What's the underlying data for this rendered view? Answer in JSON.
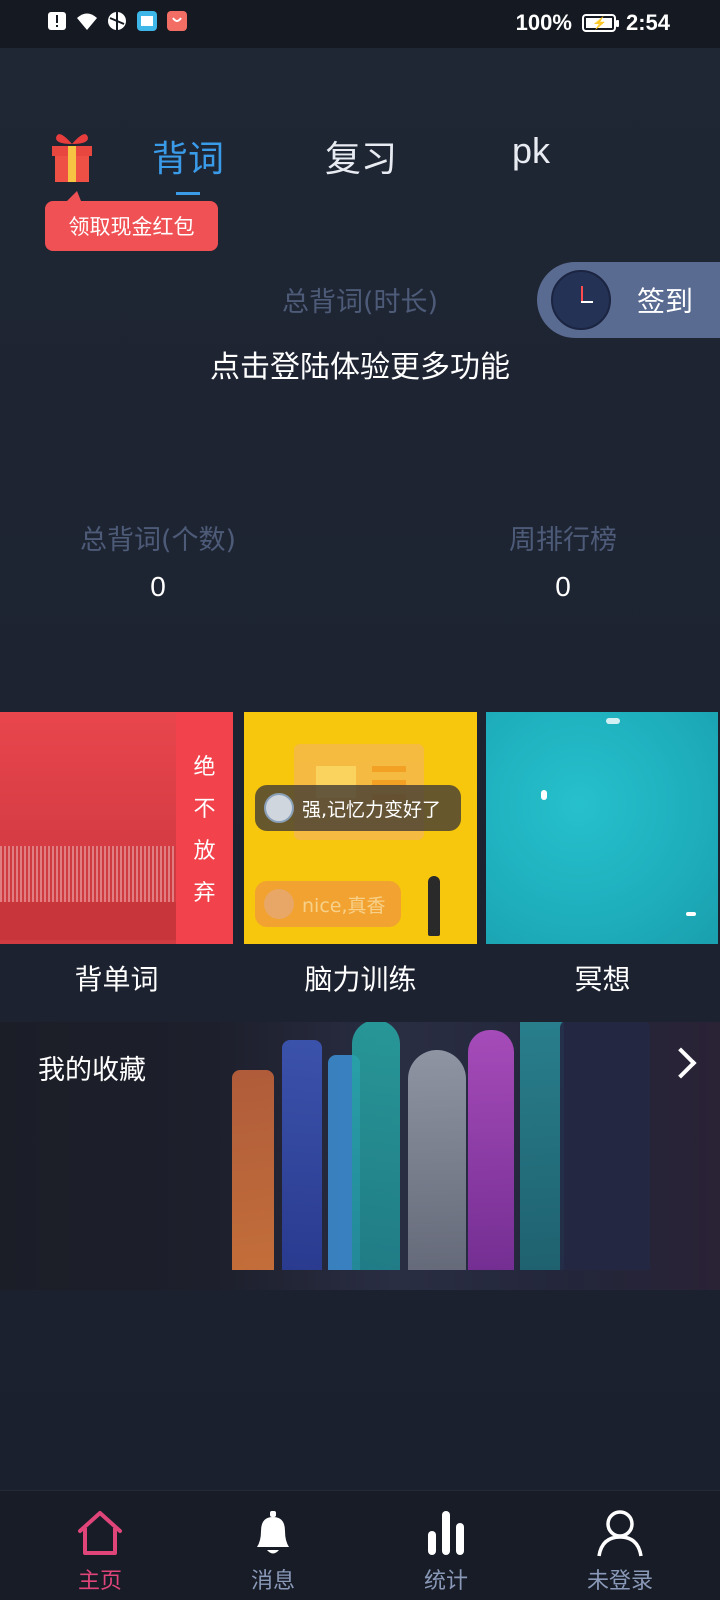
{
  "status_bar": {
    "battery_percent": "100%",
    "time": "2:54",
    "icons": [
      "alert-icon",
      "wifi-icon",
      "vpn-icon",
      "book-app-icon",
      "shop-app-icon"
    ]
  },
  "tabs": [
    {
      "label": "背词",
      "active": true
    },
    {
      "label": "复习",
      "active": false
    },
    {
      "label": "pk",
      "active": false
    }
  ],
  "red_packet": {
    "label": "领取现金红包",
    "icon": "gift-icon"
  },
  "sign_in": {
    "label": "签到",
    "icon": "clock-icon"
  },
  "summary": {
    "total_time_label": "总背词(时长)",
    "login_hint": "点击登陆体验更多功能",
    "total_count_label": "总背词(个数)",
    "total_count_value": "0",
    "weekly_rank_label": "周排行榜",
    "weekly_rank_value": "0"
  },
  "tiles": [
    {
      "label": "背单词",
      "banner_chars": [
        "绝",
        "不",
        "放",
        "弃"
      ]
    },
    {
      "label": "脑力训练",
      "bubble_1": "强,记忆力变好了",
      "bubble_2": "nice,真香"
    },
    {
      "label": "冥想"
    }
  ],
  "favorites": {
    "title": "我的收藏",
    "icon": "chevron-right-icon"
  },
  "bottom_nav": [
    {
      "label": "主页",
      "icon": "home-icon",
      "active": true
    },
    {
      "label": "消息",
      "icon": "bell-icon",
      "active": false
    },
    {
      "label": "统计",
      "icon": "stats-icon",
      "active": false
    },
    {
      "label": "未登录",
      "icon": "user-icon",
      "active": false
    }
  ],
  "colors": {
    "accent": "#3a9be8",
    "nav_active": "#e0457a",
    "red_packet": "#f05154",
    "signin_bg": "#5a6b92"
  }
}
